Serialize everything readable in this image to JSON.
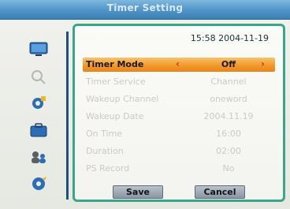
{
  "window": {
    "title": "Timer Setting"
  },
  "status": {
    "datetime": "15:58 2004-11-19"
  },
  "sidebar": {
    "items": [
      {
        "icon": "tv-icon"
      },
      {
        "icon": "search-icon"
      },
      {
        "icon": "settings-icon"
      },
      {
        "icon": "briefcase-icon"
      },
      {
        "icon": "users-icon"
      },
      {
        "icon": "media-icon"
      }
    ]
  },
  "rows": [
    {
      "label": "Timer Mode",
      "value": "Off"
    },
    {
      "label": "Timer Service",
      "value": "Channel"
    },
    {
      "label": "Wakeup Channel",
      "value": "oneword"
    },
    {
      "label": "Wakeup Date",
      "value": "2004.11.19"
    },
    {
      "label": "On Time",
      "value": "16:00"
    },
    {
      "label": "Duration",
      "value": "02:00"
    },
    {
      "label": "PS Record",
      "value": "No"
    }
  ],
  "selector": {
    "left_arrow": "‹",
    "right_arrow": "›"
  },
  "buttons": {
    "save": "Save",
    "cancel": "Cancel"
  },
  "colors": {
    "highlight": "#F29A2C",
    "panel_border": "#3AA58A",
    "titlebar": "#4F93C7"
  }
}
